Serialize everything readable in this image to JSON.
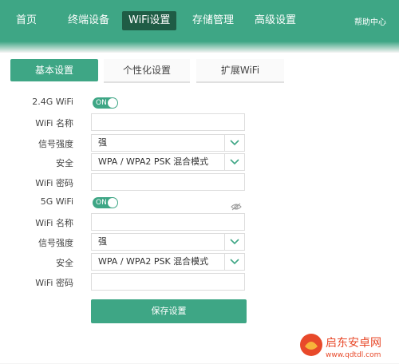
{
  "nav": {
    "items": [
      "首页",
      "终端设备",
      "WiFi设置",
      "存储管理",
      "高级设置"
    ],
    "help": "帮助中心"
  },
  "tabs": [
    "基本设置",
    "个性化设置",
    "扩展WiFi"
  ],
  "form": {
    "wifi24": {
      "label": "2.4G WiFi",
      "toggle": "ON",
      "name_label": "WiFi 名称",
      "name_value": "",
      "strength_label": "信号强度",
      "strength_value": "强",
      "security_label": "安全",
      "security_value": "WPA / WPA2 PSK 混合模式",
      "password_label": "WiFi 密码",
      "password_value": ""
    },
    "wifi5": {
      "label": "5G WiFi",
      "toggle": "ON",
      "name_label": "WiFi 名称",
      "name_value": "",
      "strength_label": "信号强度",
      "strength_value": "强",
      "security_label": "安全",
      "security_value": "WPA / WPA2 PSK 混合模式",
      "password_label": "WiFi 密码",
      "password_value": ""
    }
  },
  "save_label": "保存设置",
  "watermark": {
    "name": "启东安卓网",
    "url": "www.qdtdl.com"
  },
  "colors": {
    "accent": "#3ea685",
    "active_nav": "#1f5c45"
  },
  "icons": {
    "toggle_password": "eye-slash-icon",
    "dropdown": "chevron-down-icon"
  }
}
